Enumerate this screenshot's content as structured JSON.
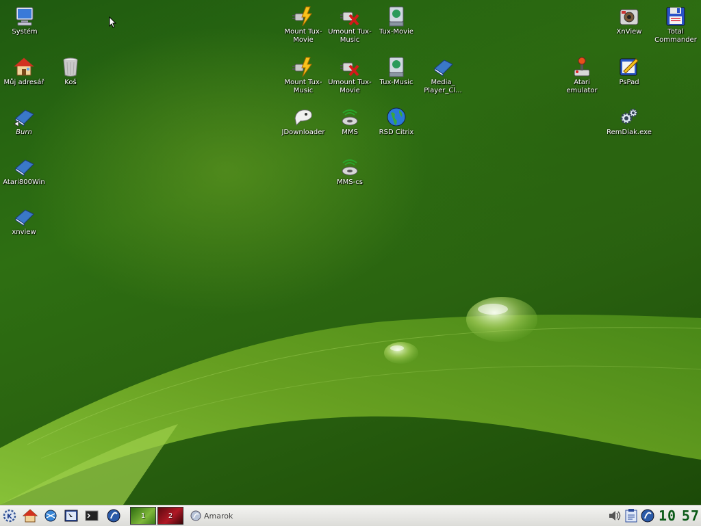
{
  "desktop_icons": {
    "system": "Systém",
    "home": "Můj adresář",
    "trash": "Koš",
    "burn": "Burn",
    "atari800": "Atari800Win",
    "xnview_link": "xnview",
    "mount_tux_movie": "Mount Tux-Movie",
    "umount_tux_music": "Umount Tux-Music",
    "tux_movie": "Tux-Movie",
    "mount_tux_music": "Mount Tux-Music",
    "umount_tux_movie": "Umount Tux-Movie",
    "tux_music": "Tux-Music",
    "media_player": "Media_ Player_Cl...",
    "jdownloader": "JDownloader",
    "mms": "MMS",
    "rsd_citrix": "RSD Citrix",
    "mms_cs": "MMS-cs",
    "xnview_app": "XnView",
    "total_commander": "Total Commander",
    "atari_emulator": "Atari emulator",
    "pspad": "PsPad",
    "remdiak": "RemDiak.exe"
  },
  "taskbar": {
    "pager": [
      "1",
      "2"
    ],
    "tasks": [
      {
        "label": "Amarok",
        "icon": "amarok-icon"
      }
    ],
    "clock": {
      "hours": "10",
      "minutes": "57"
    },
    "quick_launch": [
      "kde-menu-icon",
      "home-folder-icon",
      "konqueror-icon",
      "system-settings-icon",
      "terminal-icon",
      "amarok-icon"
    ],
    "tray": [
      "volume-icon",
      "klipper-icon",
      "amarok-tray-icon"
    ]
  },
  "colors": {
    "accent_green": "#2e6f12",
    "clock_green": "#0b5a18"
  }
}
